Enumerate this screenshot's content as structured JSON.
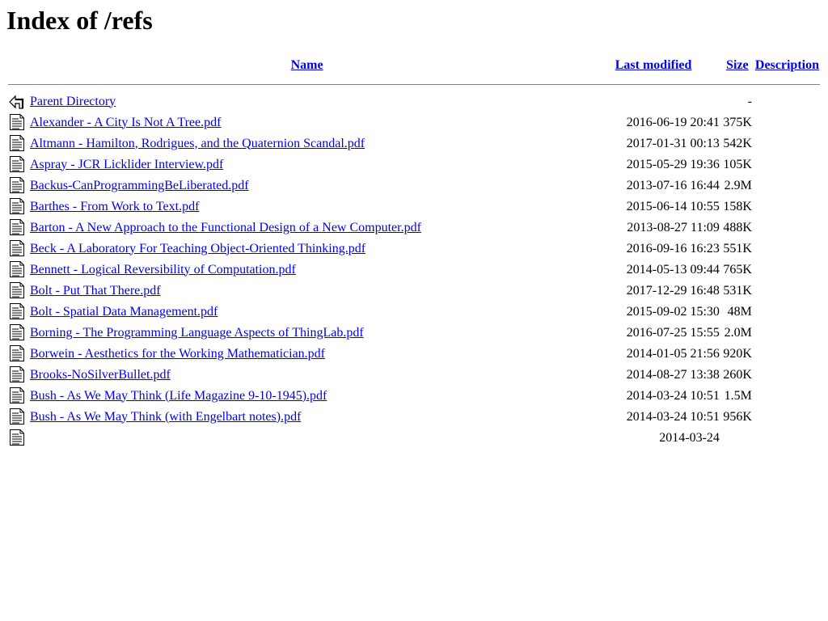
{
  "page": {
    "title": "Index of /refs"
  },
  "table": {
    "headers": {
      "name": "Name",
      "last_modified": "Last modified",
      "size": "Size",
      "description": "Description"
    },
    "parent": {
      "icon": "back-icon",
      "label": "Parent Directory",
      "size": "-"
    },
    "rows": [
      {
        "icon": "document-icon",
        "name": "Alexander - A City Is Not A Tree.pdf",
        "date": "2016-06-19",
        "time": "20:41",
        "size": "375K"
      },
      {
        "icon": "document-icon",
        "name": "Altmann - Hamilton, Rodrigues, and the Quaternion Scandal.pdf",
        "date": "2017-01-31",
        "time": "00:13",
        "size": "542K"
      },
      {
        "icon": "document-icon",
        "name": "Aspray - JCR Licklider Interview.pdf",
        "date": "2015-05-29",
        "time": "19:36",
        "size": "105K"
      },
      {
        "icon": "document-icon",
        "name": "Backus-CanProgrammingBeLiberated.pdf",
        "date": "2013-07-16",
        "time": "16:44",
        "size": "2.9M"
      },
      {
        "icon": "document-icon",
        "name": "Barthes - From Work to Text.pdf",
        "date": "2015-06-14",
        "time": "10:55",
        "size": "158K"
      },
      {
        "icon": "document-icon",
        "name": "Barton - A New Approach to the Functional Design of a New Computer.pdf",
        "date": "2013-08-27",
        "time": "11:09",
        "size": "488K"
      },
      {
        "icon": "document-icon",
        "name": "Beck - A Laboratory For Teaching Object-Oriented Thinking.pdf",
        "date": "2016-09-16",
        "time": "16:23",
        "size": "551K"
      },
      {
        "icon": "document-icon",
        "name": "Bennett - Logical Reversibility of Computation.pdf",
        "date": "2014-05-13",
        "time": "09:44",
        "size": "765K"
      },
      {
        "icon": "document-icon",
        "name": "Bolt - Put That There.pdf",
        "date": "2017-12-29",
        "time": "16:48",
        "size": "531K"
      },
      {
        "icon": "document-icon",
        "name": "Bolt - Spatial Data Management.pdf",
        "date": "2015-09-02",
        "time": "15:30",
        "size": "48M"
      },
      {
        "icon": "document-icon",
        "name": "Borning - The Programming Language Aspects of ThingLab.pdf",
        "date": "2016-07-25",
        "time": "15:55",
        "size": "2.0M"
      },
      {
        "icon": "document-icon",
        "name": "Borwein - Aesthetics for the Working Mathematician.pdf",
        "date": "2014-01-05",
        "time": "21:56",
        "size": "920K"
      },
      {
        "icon": "document-icon",
        "name": "Brooks-NoSilverBullet.pdf",
        "date": "2014-08-27",
        "time": "13:38",
        "size": "260K"
      },
      {
        "icon": "document-icon",
        "name": "Bush - As We May Think (Life Magazine 9-10-1945).pdf",
        "date": "2014-03-24",
        "time": "10:51",
        "size": "1.5M"
      },
      {
        "icon": "document-icon",
        "name": "Bush - As We May Think (with Engelbart notes).pdf",
        "date": "2014-03-24",
        "time": "10:51",
        "size": "956K"
      },
      {
        "icon": "document-icon",
        "name": "",
        "date": "2014-03-24",
        "time": "",
        "size": ""
      }
    ]
  }
}
